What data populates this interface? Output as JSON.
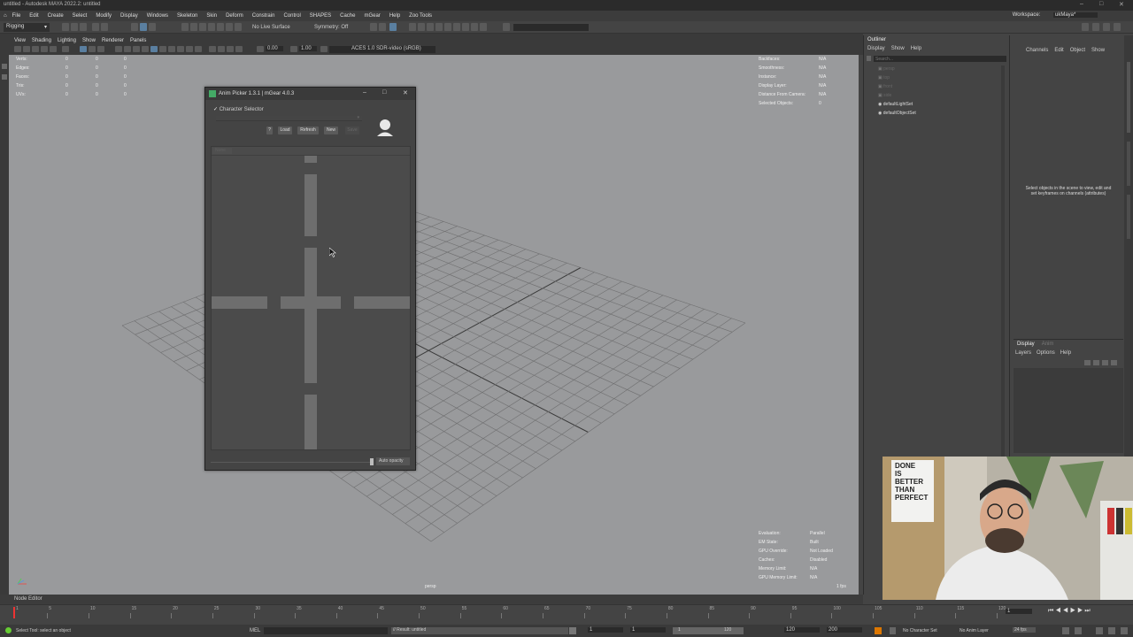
{
  "window": {
    "title": "untitled - Autodesk MAYA 2022.2: untitled"
  },
  "menubar": {
    "items": [
      "File",
      "Edit",
      "Create",
      "Select",
      "Modify",
      "Display",
      "Windows",
      "Skeleton",
      "Skin",
      "Deform",
      "Constrain",
      "Control",
      "SHAPES",
      "Cache",
      "mGear",
      "Help",
      "Zoo Tools"
    ],
    "workspace_label": "Workspace:",
    "workspace_value": "ukMaya*"
  },
  "statusline": {
    "menuset": "Rigging",
    "live_surface": "No Live Surface",
    "symmetry": "Symmetry: Off"
  },
  "viewport_menu": {
    "items": [
      "View",
      "Shading",
      "Lighting",
      "Show",
      "Renderer",
      "Panels"
    ],
    "exposure": "0.00",
    "gamma": "1.00",
    "colorspace": "ACES 1.0 SDR-video (sRGB)"
  },
  "hud_left": {
    "labels": [
      "Verts:",
      "Edges:",
      "Faces:",
      "Tris:",
      "UVs:"
    ],
    "values": [
      "0",
      "0",
      "0",
      "0",
      "0"
    ]
  },
  "hud_right_top": {
    "labels": [
      "Backfaces:",
      "Smoothness:",
      "Instance:",
      "Display Layer:",
      "Distance From Camera:",
      "Selected Objects:"
    ],
    "values": [
      "N/A",
      "N/A",
      "N/A",
      "N/A",
      "N/A",
      "0"
    ]
  },
  "hud_right_bottom": {
    "labels": [
      "Evaluation:",
      "EM State:",
      "GPU Override:",
      "Caches:",
      "Memory Limit:",
      "GPU Memory Limit:"
    ],
    "values": [
      "Parallel",
      "Built",
      "Not Loaded",
      "Disabled",
      "N/A",
      "N/A"
    ]
  },
  "viewport_camera": "persp",
  "viewport_fps": "1 fps",
  "anim_picker": {
    "title": "Anim Picker 1.3.1 | mGear 4.0.3",
    "character_selector_label": "Character Selector",
    "help_button": "?",
    "load_button": "Load",
    "refresh_button": "Refresh",
    "new_button": "New",
    "save_button": "Save",
    "tab_label": "None",
    "auto_opacity_label": "Auto opacity"
  },
  "outliner": {
    "title": "Outliner",
    "menu": [
      "Display",
      "Show",
      "Help"
    ],
    "search_placeholder": "Search...",
    "items": [
      "persp",
      "top",
      "front",
      "side",
      "defaultLightSet",
      "defaultObjectSet"
    ]
  },
  "channel_box": {
    "menu": [
      "Channels",
      "Edit",
      "Object",
      "Show"
    ],
    "empty_message": "Select objects in the scene to view, edit and set keyframes on channels (attributes)",
    "layer_tabs": [
      "Display",
      "Anim"
    ],
    "layer_menu": [
      "Layers",
      "Options",
      "Help"
    ]
  },
  "timeline": {
    "ticks": [
      "1",
      "5",
      "10",
      "15",
      "20",
      "25",
      "30",
      "35",
      "40",
      "45",
      "50",
      "55",
      "60",
      "65",
      "70",
      "75",
      "80",
      "85",
      "90",
      "95",
      "100",
      "105",
      "110",
      "115",
      "120"
    ],
    "current_frame": "1"
  },
  "range": {
    "start": "1",
    "start_inner": "1",
    "range_start": "1",
    "range_end": "120",
    "end_inner": "120",
    "end": "200",
    "char_set": "No Character Set",
    "anim_layer": "No Anim Layer",
    "fps": "24 fps"
  },
  "commandline": {
    "mode": "MEL",
    "result": "// Result: untitled"
  },
  "helpline": {
    "text": "Select Tool: select an object"
  },
  "node_editor_tab": "Node Editor",
  "webcam_poster": [
    "DONE",
    "IS",
    "BETTER",
    "THAN",
    "PERFECT"
  ]
}
